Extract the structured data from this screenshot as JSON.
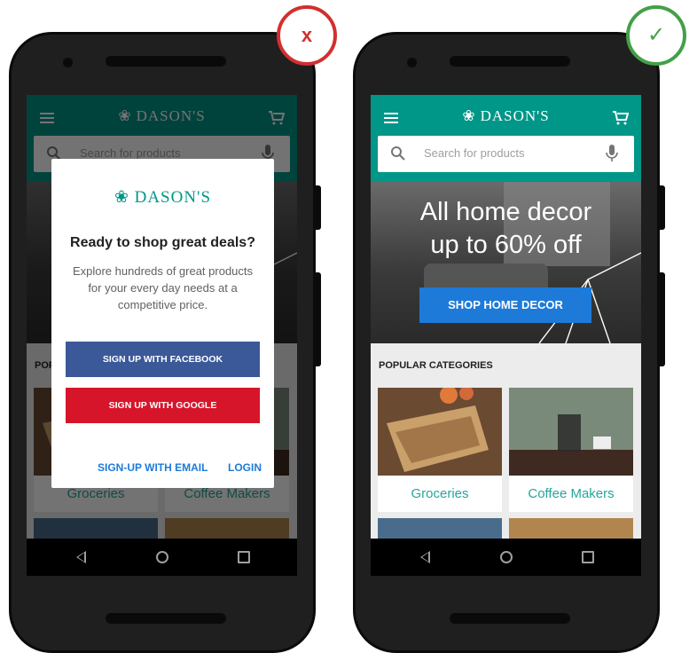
{
  "badges": {
    "bad": "x",
    "good": "✓"
  },
  "app": {
    "brand": "DASON'S",
    "search_placeholder": "Search for products",
    "hero_line1": "All home decor",
    "hero_line2": "up to 60% off",
    "hero_button": "SHOP HOME DECOR",
    "categories_heading": "POPULAR CATEGORIES",
    "categories": [
      {
        "label": "Groceries"
      },
      {
        "label": "Coffee Makers"
      }
    ]
  },
  "dialog": {
    "brand": "DASON'S",
    "title": "Ready to shop great deals?",
    "body": "Explore hundreds of great products for your every day needs at a competitive price.",
    "facebook_button": "SIGN UP WITH FACEBOOK",
    "google_button": "SIGN UP WITH GOOGLE",
    "email_link": "SIGN-UP WITH EMAIL",
    "login_link": "LOGIN"
  },
  "colors": {
    "brand_teal": "#009688",
    "accent_blue": "#1e7ad8",
    "facebook_blue": "#3b5998",
    "google_red": "#d6152a",
    "bad_red": "#d32f2f",
    "good_green": "#43a047"
  },
  "icons": [
    "menu-icon",
    "flower-logo-icon",
    "cart-icon",
    "search-icon",
    "mic-icon",
    "back-icon",
    "home-icon",
    "recents-icon"
  ]
}
